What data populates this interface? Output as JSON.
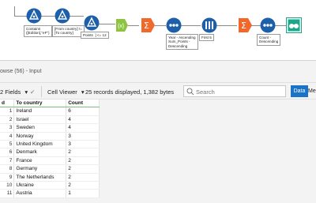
{
  "workflow": {
    "annotations": {
      "filter1": "Contains\n([Edition],\"eF\")",
      "filter2": "[From country] !=\n[To country]",
      "filter3": "Points  ] <= 12",
      "sort1": "Year - Ascending\nSum_Points -\nDescending",
      "sample": "First 5",
      "sort2": "Count -\nDescending"
    }
  },
  "results": {
    "title": "owse (56) - Input",
    "toolbar": {
      "fields": "2 Fields",
      "dropdown_caret": "▾",
      "check": "✔",
      "viewer": "Cell Viewer",
      "viewer_caret": "▾",
      "records_info": "25 records displayed, 1,382 bytes",
      "search_placeholder": "Search",
      "data_tab": "Data",
      "meta_tab": "Me"
    },
    "table": {
      "columns": [
        "d",
        "To country",
        "Count"
      ],
      "rows": [
        {
          "n": "1",
          "country": "Ireland",
          "count": "6"
        },
        {
          "n": "2",
          "country": "Israel",
          "count": "4"
        },
        {
          "n": "3",
          "country": "Sweden",
          "count": "4"
        },
        {
          "n": "4",
          "country": "Norway",
          "count": "3"
        },
        {
          "n": "5",
          "country": "United Kingdom",
          "count": "3"
        },
        {
          "n": "6",
          "country": "Denmark",
          "count": "2"
        },
        {
          "n": "7",
          "country": "France",
          "count": "2"
        },
        {
          "n": "8",
          "country": "Germany",
          "count": "2"
        },
        {
          "n": "9",
          "country": "The Netherlands",
          "count": "2"
        },
        {
          "n": "10",
          "country": "Ukraine",
          "count": "2"
        },
        {
          "n": "11",
          "country": "Austria",
          "count": "1"
        }
      ]
    }
  },
  "colors": {
    "filter_tool": "#1d5fa8",
    "formula_tool": "#8cc43f",
    "summarize_tool": "#f2682a",
    "sort_tool": "#1d5fa8",
    "browse_tool": "#1aa88a",
    "accent": "#1a73c6"
  }
}
